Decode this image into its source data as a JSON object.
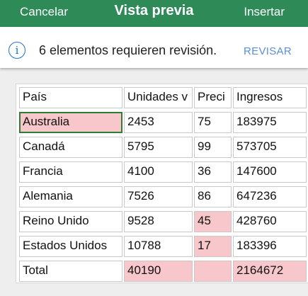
{
  "header": {
    "cancel_label": "Cancelar",
    "title": "Vista previa",
    "insert_label": "Insertar"
  },
  "notice": {
    "icon": "info-icon",
    "message": "6 elementos requieren revisión.",
    "action_label": "REVISAR"
  },
  "table": {
    "headers": [
      "País",
      "Unidades v",
      "Preci",
      "Ingresos"
    ],
    "rows": [
      [
        "Australia",
        "2453",
        "75",
        "183975"
      ],
      [
        "Canadá",
        "5795",
        "99",
        "573705"
      ],
      [
        "Francia",
        "4100",
        "36",
        "147600"
      ],
      [
        "Alemania",
        "7526",
        "86",
        "647236"
      ],
      [
        "Reino Unido",
        "9528",
        "45",
        "428760"
      ],
      [
        "Estados Unidos",
        "10788",
        "17",
        "183396"
      ],
      [
        "Total",
        "40190",
        "",
        "2164672"
      ]
    ],
    "highlight_color": "#f8c7cc",
    "selected_border_color": "#2e7d32"
  },
  "colors": {
    "header_bg": "#2e8b57",
    "accent_blue": "#1a73c8"
  }
}
